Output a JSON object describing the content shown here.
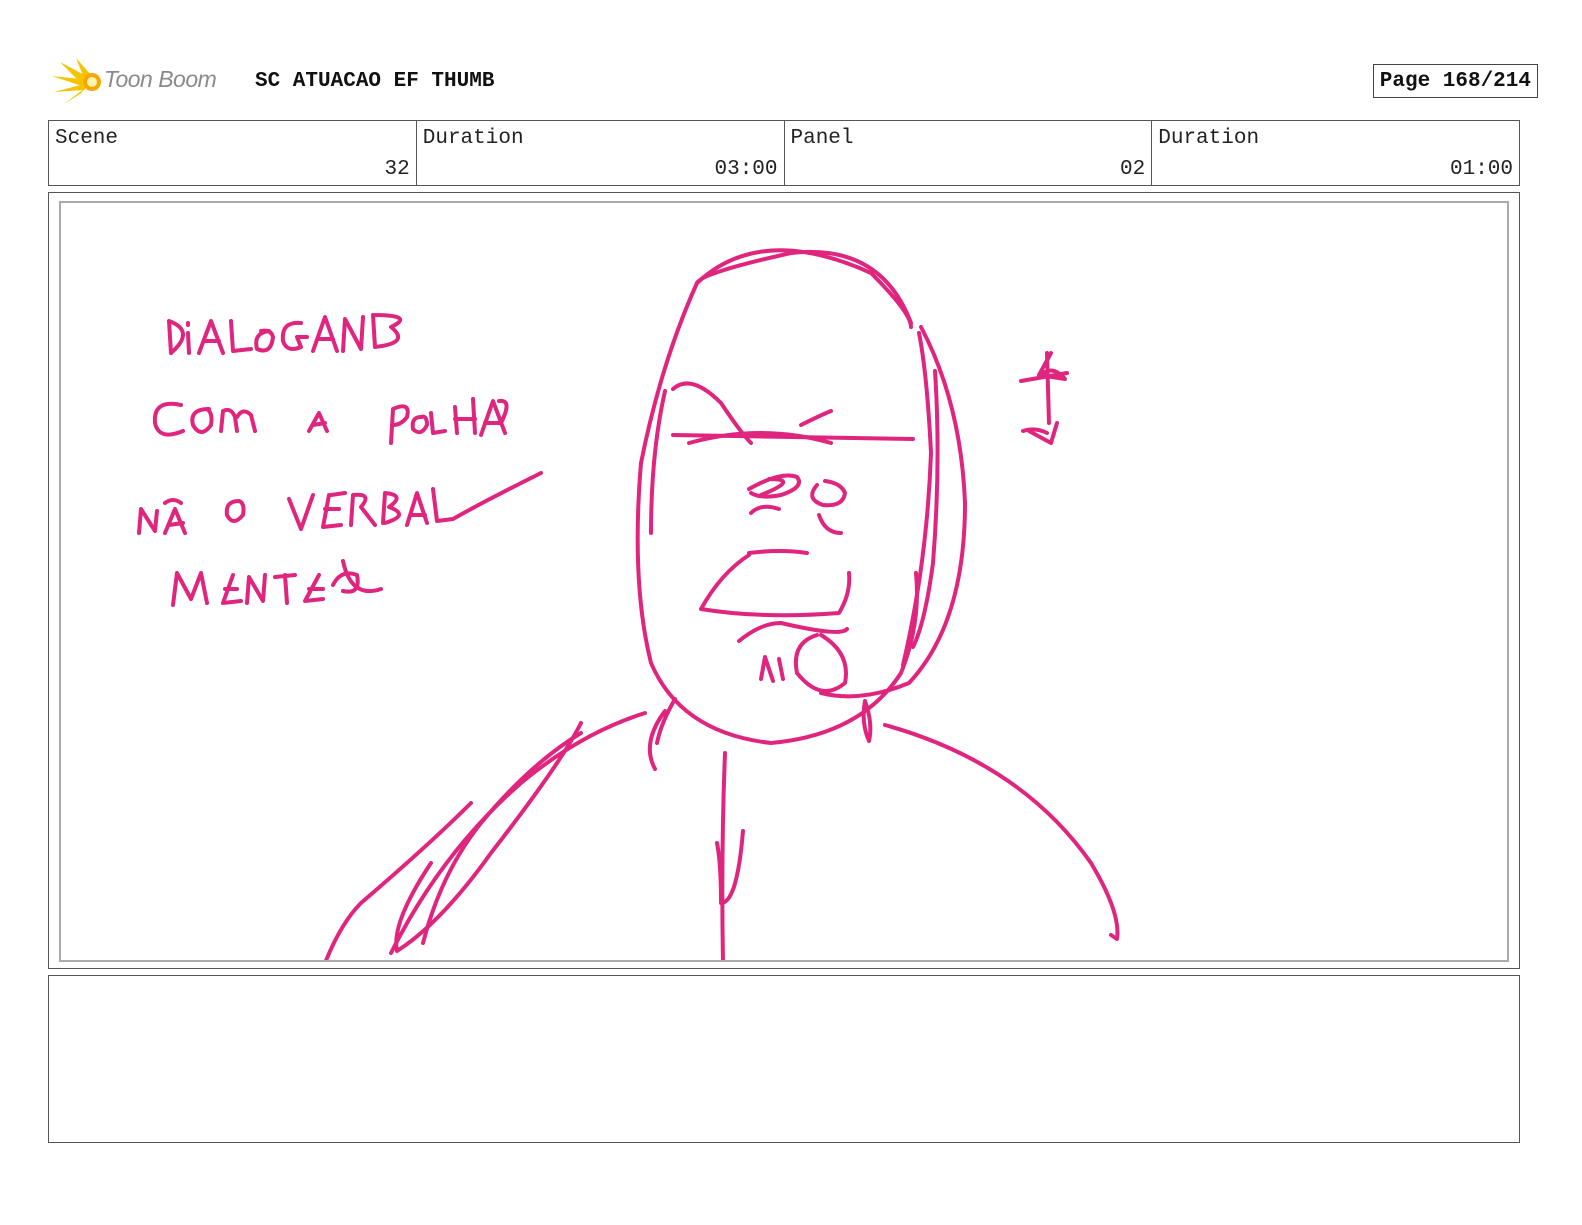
{
  "header": {
    "logo_text": "Toon Boom",
    "project_title": "SC ATUACAO EF THUMB",
    "page_indicator": "Page 168/214"
  },
  "info": {
    "scene_label": "Scene",
    "scene_value": "32",
    "scene_duration_label": "Duration",
    "scene_duration_value": "03:00",
    "panel_label": "Panel",
    "panel_value": "02",
    "panel_duration_label": "Duration",
    "panel_duration_value": "01:00"
  },
  "sketch": {
    "ink_color": "#e0257e",
    "handwritten_note": "DIALOGANDO COM A ROLHA NÃO VERBALMENTE"
  },
  "notes": {
    "text": ""
  },
  "colors": {
    "logo_flare": "#f5c400",
    "border": "#555555",
    "frame": "#aaaaaa"
  }
}
